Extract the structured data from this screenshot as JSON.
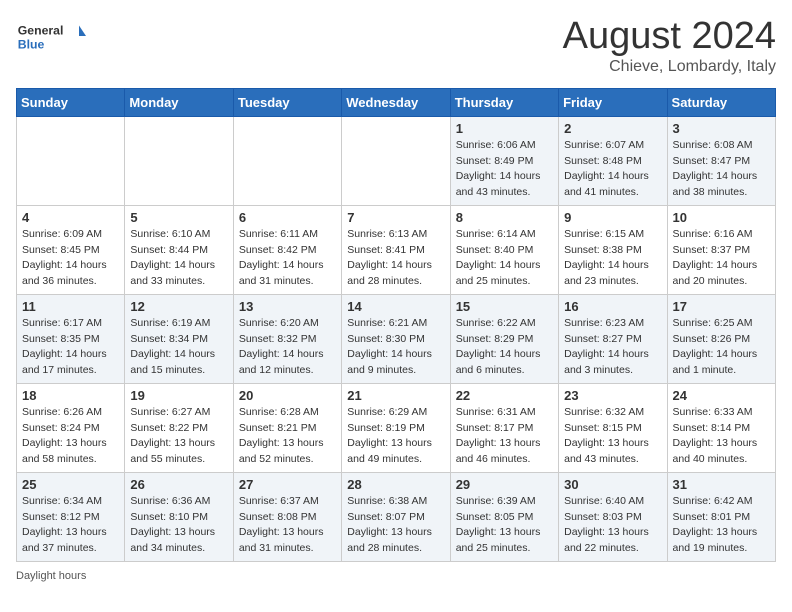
{
  "header": {
    "logo_general": "General",
    "logo_blue": "Blue",
    "month_title": "August 2024",
    "location": "Chieve, Lombardy, Italy"
  },
  "days_of_week": [
    "Sunday",
    "Monday",
    "Tuesday",
    "Wednesday",
    "Thursday",
    "Friday",
    "Saturday"
  ],
  "weeks": [
    [
      {
        "day": "",
        "info": ""
      },
      {
        "day": "",
        "info": ""
      },
      {
        "day": "",
        "info": ""
      },
      {
        "day": "",
        "info": ""
      },
      {
        "day": "1",
        "info": "Sunrise: 6:06 AM\nSunset: 8:49 PM\nDaylight: 14 hours and 43 minutes."
      },
      {
        "day": "2",
        "info": "Sunrise: 6:07 AM\nSunset: 8:48 PM\nDaylight: 14 hours and 41 minutes."
      },
      {
        "day": "3",
        "info": "Sunrise: 6:08 AM\nSunset: 8:47 PM\nDaylight: 14 hours and 38 minutes."
      }
    ],
    [
      {
        "day": "4",
        "info": "Sunrise: 6:09 AM\nSunset: 8:45 PM\nDaylight: 14 hours and 36 minutes."
      },
      {
        "day": "5",
        "info": "Sunrise: 6:10 AM\nSunset: 8:44 PM\nDaylight: 14 hours and 33 minutes."
      },
      {
        "day": "6",
        "info": "Sunrise: 6:11 AM\nSunset: 8:42 PM\nDaylight: 14 hours and 31 minutes."
      },
      {
        "day": "7",
        "info": "Sunrise: 6:13 AM\nSunset: 8:41 PM\nDaylight: 14 hours and 28 minutes."
      },
      {
        "day": "8",
        "info": "Sunrise: 6:14 AM\nSunset: 8:40 PM\nDaylight: 14 hours and 25 minutes."
      },
      {
        "day": "9",
        "info": "Sunrise: 6:15 AM\nSunset: 8:38 PM\nDaylight: 14 hours and 23 minutes."
      },
      {
        "day": "10",
        "info": "Sunrise: 6:16 AM\nSunset: 8:37 PM\nDaylight: 14 hours and 20 minutes."
      }
    ],
    [
      {
        "day": "11",
        "info": "Sunrise: 6:17 AM\nSunset: 8:35 PM\nDaylight: 14 hours and 17 minutes."
      },
      {
        "day": "12",
        "info": "Sunrise: 6:19 AM\nSunset: 8:34 PM\nDaylight: 14 hours and 15 minutes."
      },
      {
        "day": "13",
        "info": "Sunrise: 6:20 AM\nSunset: 8:32 PM\nDaylight: 14 hours and 12 minutes."
      },
      {
        "day": "14",
        "info": "Sunrise: 6:21 AM\nSunset: 8:30 PM\nDaylight: 14 hours and 9 minutes."
      },
      {
        "day": "15",
        "info": "Sunrise: 6:22 AM\nSunset: 8:29 PM\nDaylight: 14 hours and 6 minutes."
      },
      {
        "day": "16",
        "info": "Sunrise: 6:23 AM\nSunset: 8:27 PM\nDaylight: 14 hours and 3 minutes."
      },
      {
        "day": "17",
        "info": "Sunrise: 6:25 AM\nSunset: 8:26 PM\nDaylight: 14 hours and 1 minute."
      }
    ],
    [
      {
        "day": "18",
        "info": "Sunrise: 6:26 AM\nSunset: 8:24 PM\nDaylight: 13 hours and 58 minutes."
      },
      {
        "day": "19",
        "info": "Sunrise: 6:27 AM\nSunset: 8:22 PM\nDaylight: 13 hours and 55 minutes."
      },
      {
        "day": "20",
        "info": "Sunrise: 6:28 AM\nSunset: 8:21 PM\nDaylight: 13 hours and 52 minutes."
      },
      {
        "day": "21",
        "info": "Sunrise: 6:29 AM\nSunset: 8:19 PM\nDaylight: 13 hours and 49 minutes."
      },
      {
        "day": "22",
        "info": "Sunrise: 6:31 AM\nSunset: 8:17 PM\nDaylight: 13 hours and 46 minutes."
      },
      {
        "day": "23",
        "info": "Sunrise: 6:32 AM\nSunset: 8:15 PM\nDaylight: 13 hours and 43 minutes."
      },
      {
        "day": "24",
        "info": "Sunrise: 6:33 AM\nSunset: 8:14 PM\nDaylight: 13 hours and 40 minutes."
      }
    ],
    [
      {
        "day": "25",
        "info": "Sunrise: 6:34 AM\nSunset: 8:12 PM\nDaylight: 13 hours and 37 minutes."
      },
      {
        "day": "26",
        "info": "Sunrise: 6:36 AM\nSunset: 8:10 PM\nDaylight: 13 hours and 34 minutes."
      },
      {
        "day": "27",
        "info": "Sunrise: 6:37 AM\nSunset: 8:08 PM\nDaylight: 13 hours and 31 minutes."
      },
      {
        "day": "28",
        "info": "Sunrise: 6:38 AM\nSunset: 8:07 PM\nDaylight: 13 hours and 28 minutes."
      },
      {
        "day": "29",
        "info": "Sunrise: 6:39 AM\nSunset: 8:05 PM\nDaylight: 13 hours and 25 minutes."
      },
      {
        "day": "30",
        "info": "Sunrise: 6:40 AM\nSunset: 8:03 PM\nDaylight: 13 hours and 22 minutes."
      },
      {
        "day": "31",
        "info": "Sunrise: 6:42 AM\nSunset: 8:01 PM\nDaylight: 13 hours and 19 minutes."
      }
    ]
  ],
  "footer": {
    "note": "Daylight hours"
  }
}
